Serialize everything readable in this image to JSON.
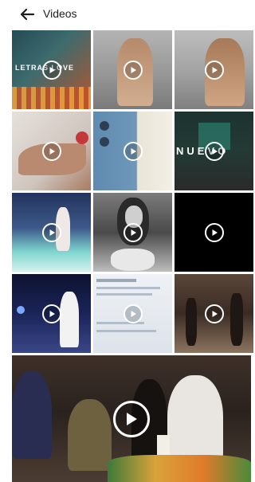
{
  "header": {
    "back_icon": "arrow-left-icon",
    "title": "Videos"
  },
  "play_icon": "play-circle-icon",
  "thumbnails": [
    {
      "name": "video-thumb-letras-love",
      "text": "LETRAS LOVE",
      "colors": [
        "#2a6f7c",
        "#c0522b"
      ]
    },
    {
      "name": "video-thumb-beach-woman-1",
      "text": "",
      "colors": [
        "#8f8f8f",
        "#caa58a"
      ]
    },
    {
      "name": "video-thumb-beach-woman-2",
      "text": "",
      "colors": [
        "#9a9a9a",
        "#c59e7e"
      ]
    },
    {
      "name": "video-thumb-bridal-shoes",
      "text": "",
      "colors": [
        "#d9d3cf",
        "#b07a5e"
      ]
    },
    {
      "name": "video-thumb-blue-fabric",
      "text": "",
      "colors": [
        "#5e8aaf",
        "#e9e3d6"
      ]
    },
    {
      "name": "video-thumb-nuevo",
      "text": "NUEVO",
      "colors": [
        "#1d3330",
        "#2f2f2f"
      ]
    },
    {
      "name": "video-thumb-dance-smoke",
      "text": "",
      "colors": [
        "#2b3d6a",
        "#7fd6cf"
      ]
    },
    {
      "name": "video-thumb-bride-bw",
      "text": "",
      "colors": [
        "#3a3a3a",
        "#e2e2e2"
      ]
    },
    {
      "name": "video-thumb-black",
      "text": "",
      "colors": [
        "#000000",
        "#000000"
      ]
    },
    {
      "name": "video-thumb-dj-stage",
      "text": "",
      "colors": [
        "#12183a",
        "#5a6ab8"
      ]
    },
    {
      "name": "video-thumb-screen-doc",
      "text": "",
      "colors": [
        "#e8ecf1",
        "#c9d2dd"
      ]
    },
    {
      "name": "video-thumb-party-hall",
      "text": "",
      "colors": [
        "#3c2c25",
        "#8c6d55"
      ]
    },
    {
      "name": "video-thumb-wedding-ceremony",
      "text": "",
      "colors": [
        "#2c2420",
        "#6d5a45"
      ]
    }
  ]
}
